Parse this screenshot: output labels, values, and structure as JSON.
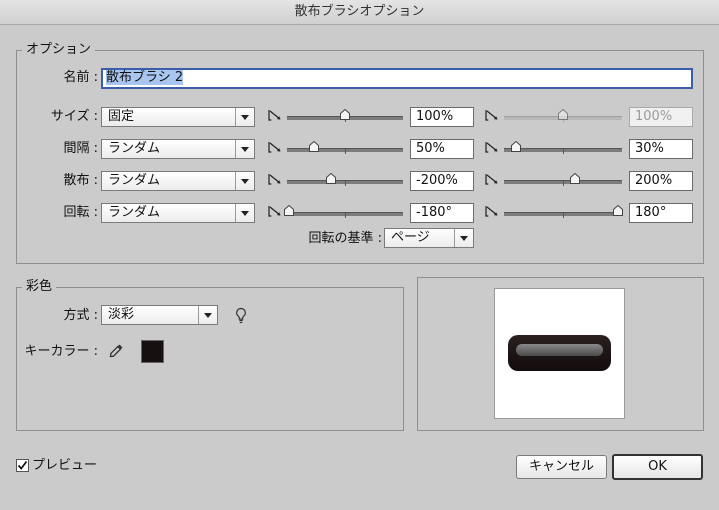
{
  "window": {
    "title": "散布ブラシオプション"
  },
  "options_group": {
    "legend": "オプション",
    "name_label": "名前 :",
    "name_value": "散布ブラシ 2",
    "rows": [
      {
        "label": "サイズ :",
        "select": "固定",
        "min_value": "100%",
        "max_value": "100%",
        "min_pos": 0.5,
        "max_pos": 0.5,
        "max_disabled": true
      },
      {
        "label": "間隔 :",
        "select": "ランダム",
        "min_value": "50%",
        "max_value": "30%",
        "min_pos": 0.23,
        "max_pos": 0.1,
        "max_disabled": false
      },
      {
        "label": "散布 :",
        "select": "ランダム",
        "min_value": "-200%",
        "max_value": "200%",
        "min_pos": 0.38,
        "max_pos": 0.6,
        "max_disabled": false
      },
      {
        "label": "回転 :",
        "select": "ランダム",
        "min_value": "-180°",
        "max_value": "180°",
        "min_pos": 0.02,
        "max_pos": 0.97,
        "max_disabled": false
      }
    ],
    "rotation_basis_label": "回転の基準 :",
    "rotation_basis_value": "ページ"
  },
  "coloring_group": {
    "legend": "彩色",
    "method_label": "方式 :",
    "method_value": "淡彩",
    "key_color_label": "キーカラー :",
    "key_color": "#161010"
  },
  "preview_checkbox": {
    "label": "プレビュー",
    "checked": true
  },
  "buttons": {
    "cancel": "キャンセル",
    "ok": "OK"
  }
}
